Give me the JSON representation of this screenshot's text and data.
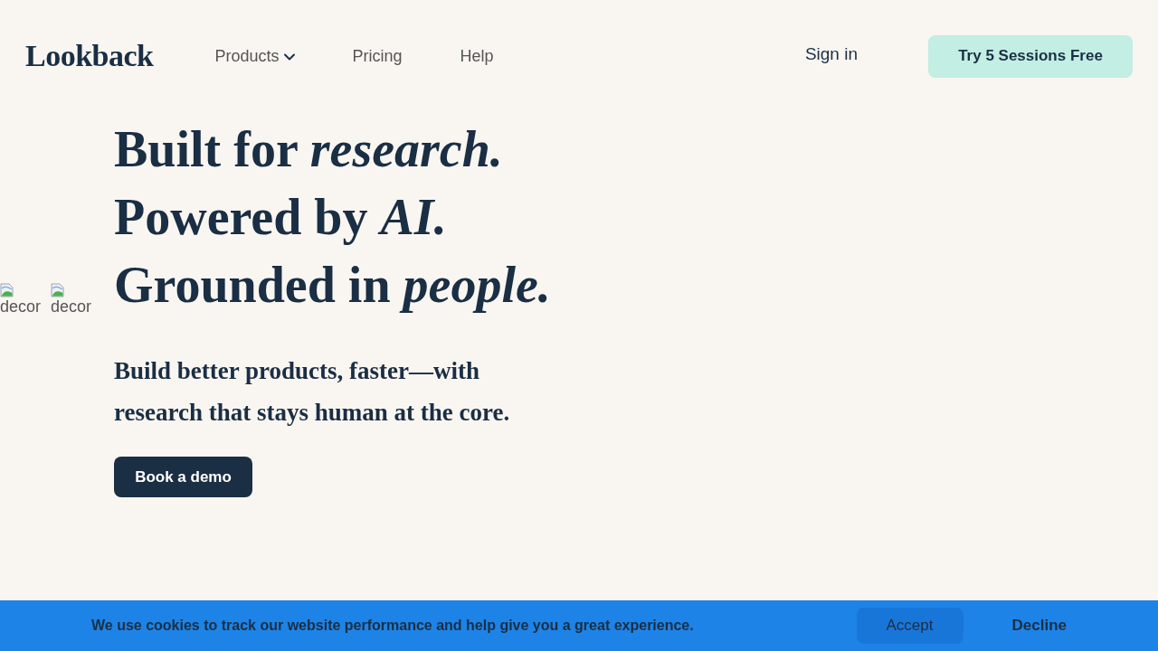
{
  "header": {
    "logo": "Lookback",
    "nav": [
      {
        "label": "Products",
        "kind": "dropdown"
      },
      {
        "label": "Pricing",
        "kind": "link"
      },
      {
        "label": "Help",
        "kind": "link"
      }
    ],
    "sign_in": "Sign in",
    "cta": "Try 5 Sessions Free"
  },
  "decor_images": [
    {
      "alt": "decor"
    },
    {
      "alt": "decor"
    }
  ],
  "hero": {
    "headline": [
      "Built for *research.*",
      "Powered by *AI.*",
      "Grounded in *people.*"
    ],
    "subheading": "Build better products, faster—with research that stays human at the core.",
    "button": "Book a demo"
  },
  "cookie_bar": {
    "message": "We use cookies to track our website performance and help give you a great experience.",
    "accept": "Accept",
    "decline": "Decline"
  }
}
